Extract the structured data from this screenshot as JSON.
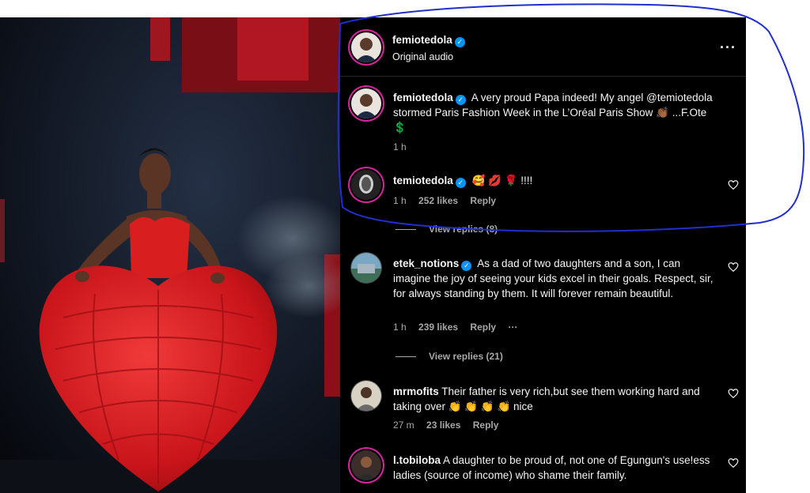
{
  "post": {
    "author": "femiotedola",
    "subtitle": "Original audio",
    "menu_icon": "more-horizontal-icon"
  },
  "comments": [
    {
      "user": "femiotedola",
      "verified": true,
      "text": "A very proud Papa indeed! My angel @temiotedola stormed Paris Fashion Week in the L’Oréal Paris Show 👏🏾 ...F.Ote 💲",
      "time": "1 h",
      "likes": "",
      "reply": ""
    },
    {
      "user": "temiotedola",
      "verified": true,
      "text": "🥰 💋 🌹 !!!!",
      "time": "1 h",
      "likes": "252 likes",
      "reply": "Reply",
      "view_replies": "View replies (8)"
    },
    {
      "user": "etek_notions",
      "verified": true,
      "text": "As a dad of two daughters and a son, I can imagine the joy of seeing your kids excel in their goals. Respect, sir, for always standing by them. It will forever remain beautiful.",
      "time": "1 h",
      "likes": "239 likes",
      "reply": "Reply",
      "more": "···",
      "view_replies": "View replies (21)"
    },
    {
      "user": "mrmofits",
      "verified": false,
      "text": "Their father is very rich,but see them working hard and taking over 👏 👏 👏 👏 nice",
      "time": "27 m",
      "likes": "23 likes",
      "reply": "Reply"
    },
    {
      "user": "l.tobiloba",
      "verified": false,
      "text": "A daughter to be proud of, not one of Egungun's use!ess ladies (source of income) who shame their family.",
      "time": "",
      "likes": "",
      "reply": ""
    }
  ],
  "colors": {
    "panel_bg": "#000000",
    "verified": "#0095f6",
    "annotation": "#1f2fd0",
    "dress": "#d81e1e"
  }
}
